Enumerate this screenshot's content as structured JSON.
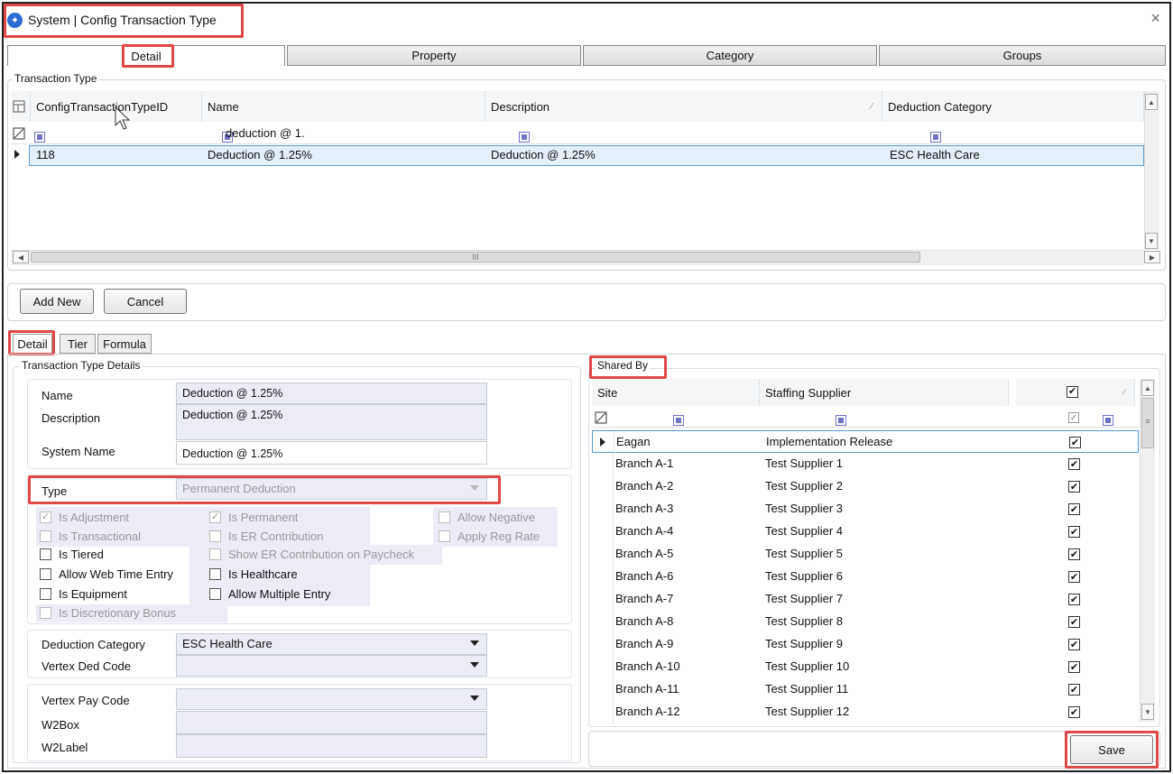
{
  "window": {
    "title": "System | Config Transaction Type",
    "close_glyph": "×"
  },
  "top_tabs": [
    "Detail",
    "Property",
    "Category",
    "Groups"
  ],
  "transaction_type": {
    "group_label": "Transaction Type",
    "columns": [
      "ConfigTransactionTypeID",
      "Name",
      "Description",
      "Deduction Category"
    ],
    "filter_name": "deduction @ 1.",
    "row": {
      "id": "118",
      "name": "Deduction @ 1.25%",
      "description": "Deduction @ 1.25%",
      "deduction_category": "ESC Health Care"
    },
    "hscroll_grip": "III"
  },
  "actions": {
    "add_new": "Add New",
    "cancel": "Cancel"
  },
  "sub_tabs": [
    "Detail",
    "Tier",
    "Formula"
  ],
  "details": {
    "group_label": "Transaction Type Details",
    "name_label": "Name",
    "name_value": "Deduction @ 1.25%",
    "description_label": "Description",
    "description_value": "Deduction @ 1.25%",
    "system_name_label": "System Name",
    "system_name_value": "Deduction @ 1.25%",
    "type_label": "Type",
    "type_value": "Permanent Deduction",
    "checkboxes": {
      "is_adjustment": "Is Adjustment",
      "is_transactional": "Is Transactional",
      "is_tiered": "Is Tiered",
      "allow_web_time_entry": "Allow Web Time Entry",
      "is_equipment": "Is Equipment",
      "is_discretionary_bonus": "Is Discretionary Bonus",
      "is_permanent": "Is Permanent",
      "is_er_contribution": "Is ER Contribution",
      "show_er_contribution": "Show ER Contribution on Paycheck",
      "is_healthcare": "Is Healthcare",
      "allow_multiple_entry": "Allow Multiple Entry",
      "allow_negative": "Allow Negative",
      "apply_reg_rate": "Apply Reg Rate"
    },
    "deduction_category_label": "Deduction Category",
    "deduction_category_value": "ESC Health Care",
    "vertex_ded_code_label": "Vertex Ded Code",
    "vertex_pay_code_label": "Vertex Pay Code",
    "w2box_label": "W2Box",
    "w2label_label": "W2Label"
  },
  "shared_by": {
    "label": "Shared By",
    "columns": [
      "Site",
      "Staffing Supplier"
    ],
    "check_glyph": "✔",
    "rows": [
      {
        "site": "Eagan",
        "supplier": "Implementation Release"
      },
      {
        "site": "Branch A-1",
        "supplier": "Test Supplier 1"
      },
      {
        "site": "Branch A-2",
        "supplier": "Test Supplier 2"
      },
      {
        "site": "Branch A-3",
        "supplier": "Test Supplier 3"
      },
      {
        "site": "Branch A-4",
        "supplier": "Test Supplier 4"
      },
      {
        "site": "Branch A-5",
        "supplier": "Test Supplier 5"
      },
      {
        "site": "Branch A-6",
        "supplier": "Test Supplier 6"
      },
      {
        "site": "Branch A-7",
        "supplier": "Test Supplier 7"
      },
      {
        "site": "Branch A-8",
        "supplier": "Test Supplier 8"
      },
      {
        "site": "Branch A-9",
        "supplier": "Test Supplier 9"
      },
      {
        "site": "Branch A-10",
        "supplier": "Test Supplier 10"
      },
      {
        "site": "Branch A-11",
        "supplier": "Test Supplier 11"
      },
      {
        "site": "Branch A-12",
        "supplier": "Test Supplier 12"
      }
    ]
  },
  "save_label": "Save",
  "colors": {
    "highlight": "#e04848",
    "accent": "#2b6cd1",
    "selection": "#e4effb"
  }
}
